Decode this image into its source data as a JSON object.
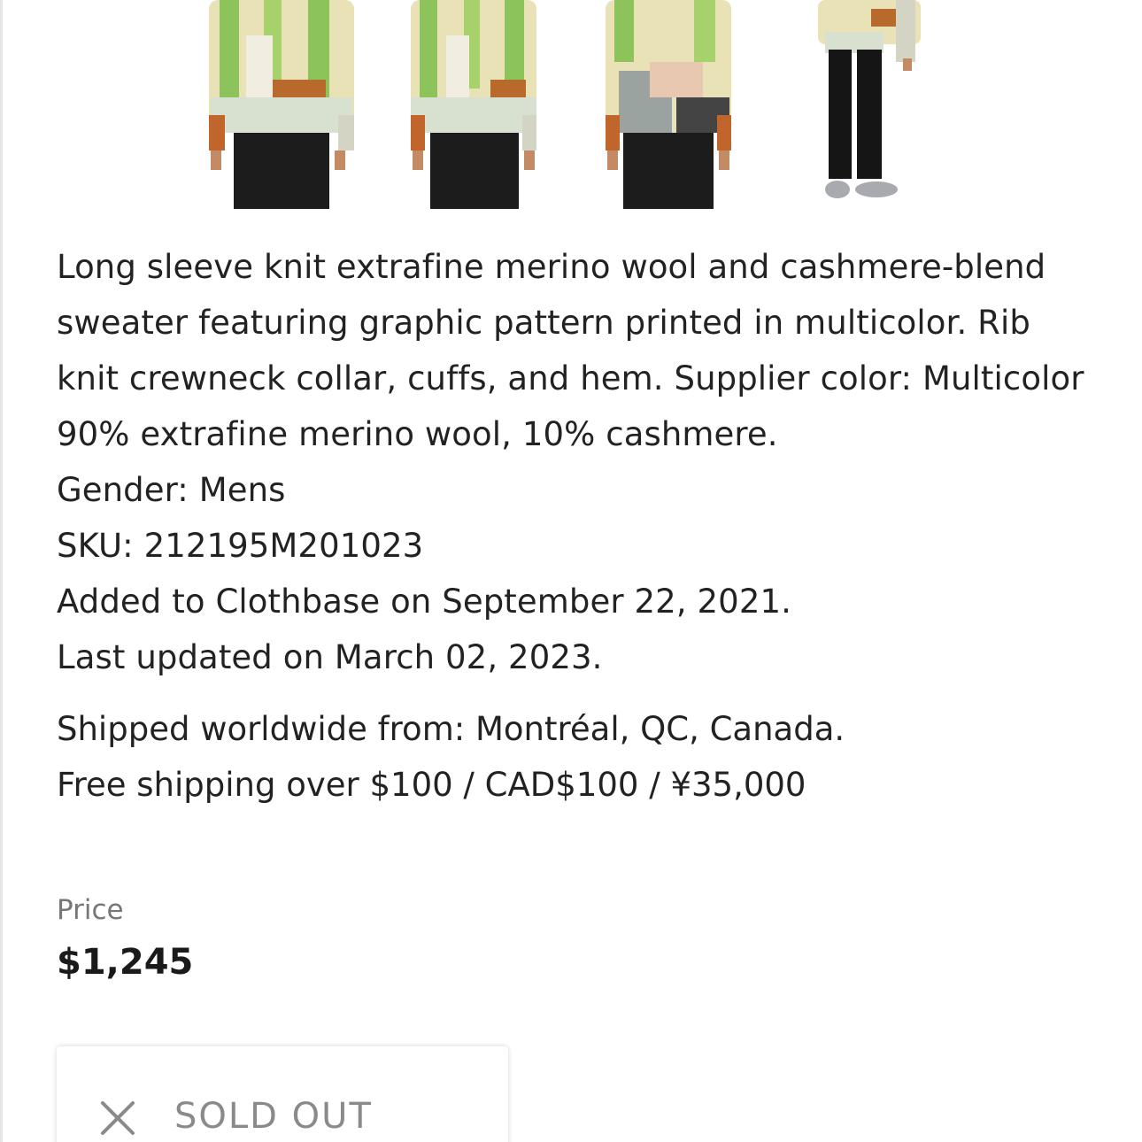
{
  "description": {
    "lines": [
      "Long sleeve knit extrafine merino wool and cashmere-blend",
      "sweater featuring graphic pattern printed in multicolor. Rib",
      "knit crewneck collar, cuffs, and hem. Supplier color: Multicolor",
      "90% extrafine merino wool, 10% cashmere.",
      "Gender: Mens",
      "SKU: 212195M201023",
      "Added to Clothbase on September 22, 2021.",
      "Last updated on March 02, 2023."
    ]
  },
  "shipping": {
    "from": "Shipped worldwide from: Montréal, QC, Canada.",
    "free": "Free shipping over $100 / CAD$100 / ¥35,000"
  },
  "price": {
    "label": "Price",
    "value": "$1,245"
  },
  "stock": {
    "status": "SOLD OUT",
    "icon": "close-icon"
  },
  "colors": {
    "text": "#222222",
    "muted": "#777777",
    "sold_out": "#8a8a8a"
  }
}
